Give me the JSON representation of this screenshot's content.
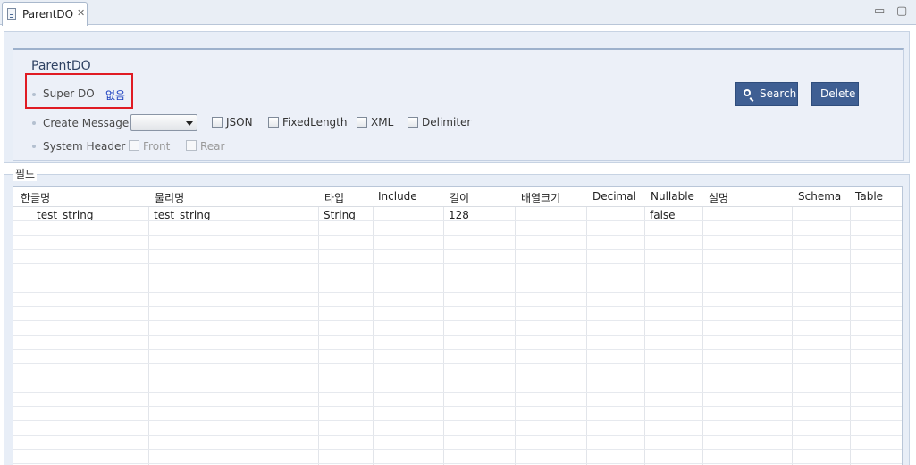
{
  "tab": {
    "title": "ParentDO"
  },
  "window": {
    "minimize": "▭",
    "maximize": "▢"
  },
  "form": {
    "title": "ParentDO",
    "super_do_label": "Super DO",
    "super_do_value": "없음",
    "create_message_label": "Create Message",
    "create_message_value": "",
    "system_header_label": "System Header",
    "options": {
      "json": "JSON",
      "fixed_length": "FixedLength",
      "xml": "XML",
      "delimiter": "Delimiter"
    },
    "header_options": {
      "front": "Front",
      "rear": "Rear"
    }
  },
  "buttons": {
    "search": "Search",
    "delete": "Delete"
  },
  "fields": {
    "section_title": "필드",
    "columns": [
      "한글명",
      "물리명",
      "타입",
      "Include",
      "길이",
      "배열크기",
      "Decimal",
      "Nullable",
      "설명",
      "Schema",
      "Table"
    ],
    "rows": [
      [
        "test_string",
        "test_string",
        "String",
        "",
        "128",
        "",
        "",
        "false",
        "",
        "",
        ""
      ]
    ]
  },
  "colors": {
    "button_bg": "#3f5f93",
    "link": "#1a3fc0",
    "highlight_box": "#e01b24"
  }
}
